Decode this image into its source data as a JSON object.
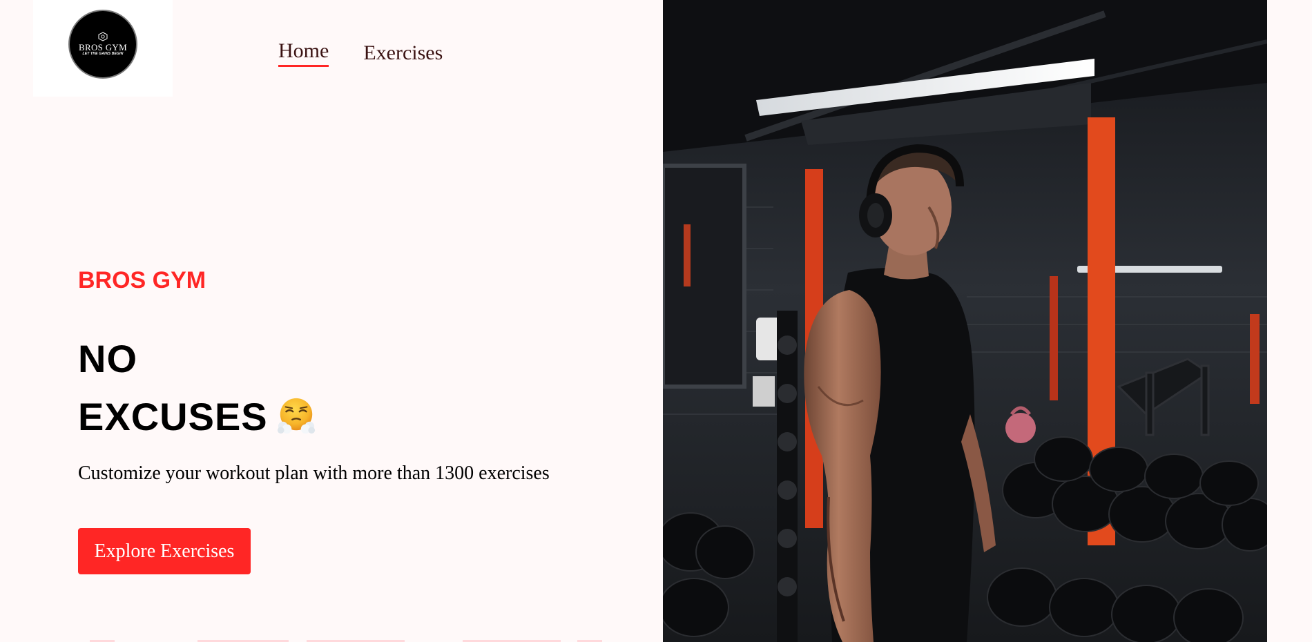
{
  "logo": {
    "name": "BROS GYM",
    "tagline": "LET THE GAINS BEGIN"
  },
  "nav": {
    "items": [
      {
        "label": "Home",
        "active": true
      },
      {
        "label": "Exercises",
        "active": false
      }
    ]
  },
  "hero": {
    "brand": "BROS GYM",
    "headline_line1": "NO",
    "headline_line2": "EXCUSES",
    "headline_emoji": "face-with-steam-from-nose",
    "subtitle": "Customize your workout plan with more than 1300 exercises",
    "cta_label": "Explore Exercises"
  },
  "colors": {
    "accent": "#ff2625",
    "background": "#fff9f9",
    "text": "#000000",
    "nav_text": "#3a1212"
  },
  "image": {
    "subject": "bodybuilder-in-gym-photo"
  }
}
